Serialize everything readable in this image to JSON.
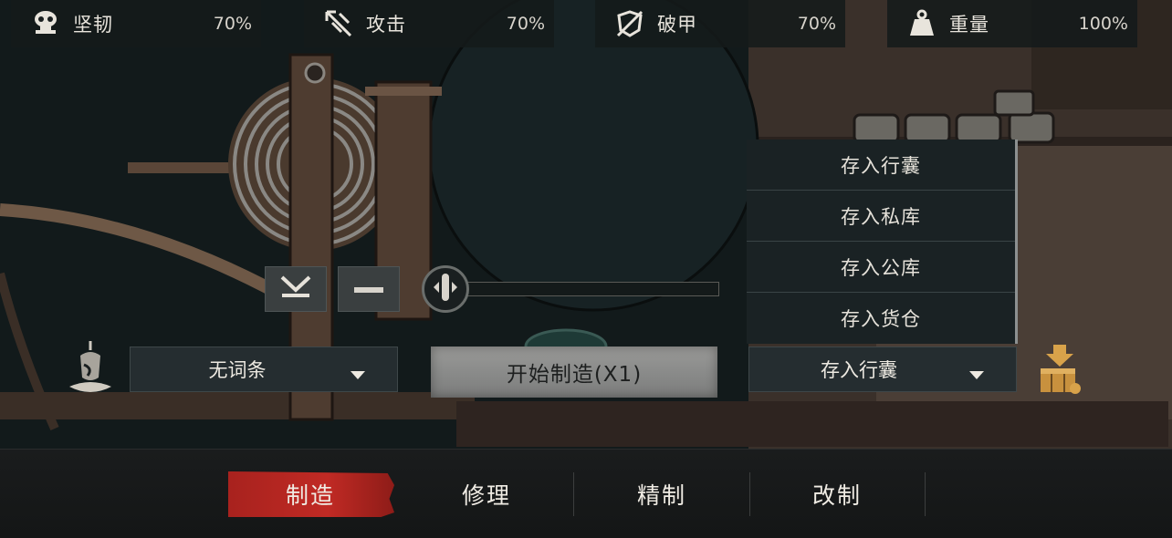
{
  "stats": [
    {
      "icon": "shield-skull-icon",
      "label": "坚韧",
      "value": "70%"
    },
    {
      "icon": "crossed-arrows-icon",
      "label": "攻击",
      "value": "70%"
    },
    {
      "icon": "broken-armor-icon",
      "label": "破甲",
      "value": "70%"
    },
    {
      "icon": "weight-icon",
      "label": "重量",
      "value": "100%"
    }
  ],
  "quantity_slider": {
    "level": 0
  },
  "affix_dropdown": {
    "selected": "无词条",
    "icon": "incense-burner-icon"
  },
  "craft_button": {
    "label": "开始制造(X1)"
  },
  "storage_dropdown": {
    "selected": "存入行囊",
    "options": [
      "存入行囊",
      "存入私库",
      "存入公库",
      "存入货仓"
    ],
    "icon": "storage-chest-icon"
  },
  "tabs": [
    {
      "label": "制造",
      "active": true
    },
    {
      "label": "修理",
      "active": false
    },
    {
      "label": "精制",
      "active": false
    },
    {
      "label": "改制",
      "active": false
    }
  ],
  "colors": {
    "accent": "#b8261f",
    "gold": "#d8a24a",
    "panel": "#252d30"
  }
}
